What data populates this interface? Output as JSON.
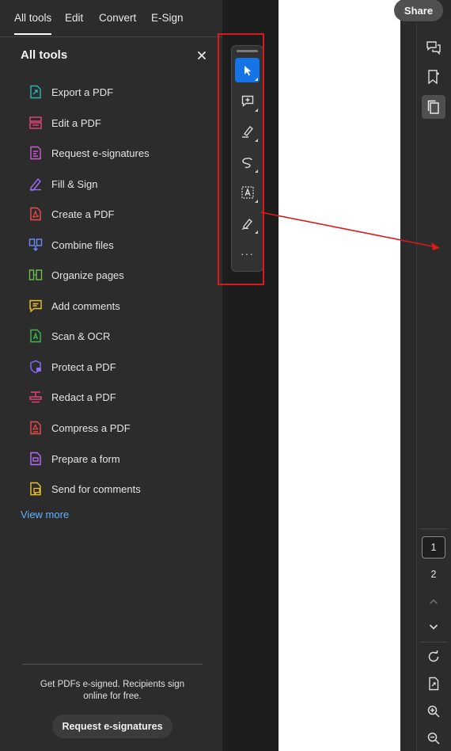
{
  "top_tabs": [
    "All tools",
    "Edit",
    "Convert",
    "E-Sign"
  ],
  "panel": {
    "title": "All tools",
    "close_label": "×",
    "tools": [
      {
        "label": "Export a PDF",
        "icon": "export-pdf-icon",
        "color": "#2ab7b0"
      },
      {
        "label": "Edit a PDF",
        "icon": "edit-pdf-icon",
        "color": "#e8457a"
      },
      {
        "label": "Request e-signatures",
        "icon": "request-esign-icon",
        "color": "#c95ad6"
      },
      {
        "label": "Fill & Sign",
        "icon": "fill-sign-icon",
        "color": "#9d6cf5"
      },
      {
        "label": "Create a PDF",
        "icon": "create-pdf-icon",
        "color": "#f04b4b"
      },
      {
        "label": "Combine files",
        "icon": "combine-files-icon",
        "color": "#6a8cf5"
      },
      {
        "label": "Organize pages",
        "icon": "organize-pages-icon",
        "color": "#6bc04b"
      },
      {
        "label": "Add comments",
        "icon": "add-comments-icon",
        "color": "#e9c22a"
      },
      {
        "label": "Scan & OCR",
        "icon": "scan-ocr-icon",
        "color": "#3fb950"
      },
      {
        "label": "Protect a PDF",
        "icon": "protect-pdf-icon",
        "color": "#8a6cf5"
      },
      {
        "label": "Redact a PDF",
        "icon": "redact-pdf-icon",
        "color": "#e8457a"
      },
      {
        "label": "Compress a PDF",
        "icon": "compress-pdf-icon",
        "color": "#f04b4b"
      },
      {
        "label": "Prepare a form",
        "icon": "prepare-form-icon",
        "color": "#b96cf5"
      },
      {
        "label": "Send for comments",
        "icon": "send-comments-icon",
        "color": "#e9c22a"
      }
    ],
    "view_more": "View more",
    "promo_text": "Get PDFs e-signed. Recipients sign online for free.",
    "promo_button": "Request e-signatures"
  },
  "quick_toolbar": {
    "tools": [
      "select-cursor-icon",
      "add-comment-icon",
      "highlight-pen-icon",
      "draw-freehand-icon",
      "text-select-icon",
      "signature-pen-icon",
      "more-icon"
    ],
    "selected": "select-cursor-icon",
    "more_label": "···"
  },
  "header": {
    "share_label": "Share"
  },
  "right_rail": {
    "top_tools": [
      "comments-panel-icon",
      "bookmarks-icon",
      "page-thumbnails-icon"
    ],
    "selected": "page-thumbnails-icon",
    "pages": [
      "1",
      "2"
    ],
    "current_page": "1",
    "bottom_tools": [
      "prev-page-icon",
      "next-page-icon",
      "rotate-icon",
      "page-extract-icon",
      "zoom-in-icon",
      "zoom-out-icon"
    ]
  },
  "colors": {
    "accent": "#1473e6",
    "annotation": "#d91a1a",
    "link": "#5fb2ff"
  }
}
